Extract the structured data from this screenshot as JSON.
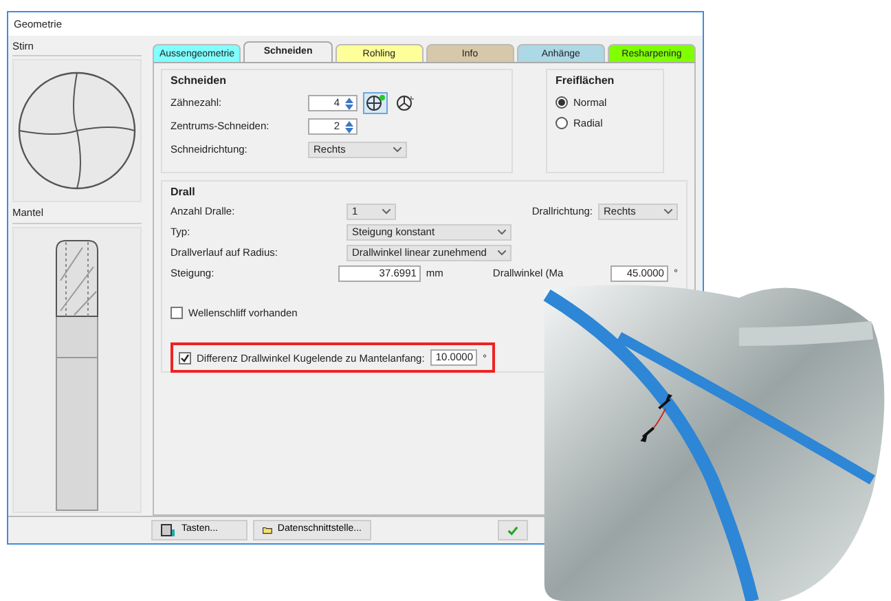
{
  "window": {
    "title": "Geometrie"
  },
  "left_panel": {
    "front_label": "Stirn",
    "shank_label": "Mantel"
  },
  "tabs": [
    {
      "label": "Aussengeometrie",
      "color": "#80ffff",
      "selected": false
    },
    {
      "label": "Schneiden",
      "color": "#f0f0f0",
      "selected": true
    },
    {
      "label": "Rohling",
      "color": "#ffff99",
      "selected": false
    },
    {
      "label": "Info",
      "color": "#d6c8a8",
      "selected": false
    },
    {
      "label": "Anhänge",
      "color": "#add8e6",
      "selected": false
    },
    {
      "label": "Resharpening",
      "color": "#80ff00",
      "selected": false
    }
  ],
  "schneiden": {
    "title": "Schneiden",
    "fields": [
      {
        "label": "Zähnezahl:",
        "value": "4",
        "kind": "spin"
      },
      {
        "label": "Zentrums-Schneiden:",
        "value": "2",
        "kind": "spin"
      },
      {
        "label": "Schneidrichtung:",
        "value": "Rechts",
        "kind": "select"
      }
    ],
    "tooth_modes": [
      {
        "selected": true
      },
      {
        "selected": false
      }
    ]
  },
  "freiflaechen": {
    "title": "Freiflächen",
    "options": [
      {
        "label": "Normal",
        "selected": true
      },
      {
        "label": "Radial",
        "selected": false
      }
    ]
  },
  "drall": {
    "title": "Drall",
    "rows": [
      {
        "label": "Anzahl Dralle:",
        "value": "1",
        "kind": "select_small"
      },
      {
        "label": "Typ:",
        "value": "Steigung konstant",
        "kind": "select"
      },
      {
        "label": "Drallverlauf auf Radius:",
        "value": "Drallwinkel linear zunehmend",
        "kind": "select"
      },
      {
        "label": "Steigung:",
        "value": "37.6991",
        "unit": "mm",
        "kind": "input"
      }
    ],
    "direction": {
      "label": "Drallrichtung:",
      "value": "Rechts"
    },
    "angle": {
      "label": "Drallwinkel (Ma",
      "value": "45.0000",
      "unit": "°"
    },
    "wave": {
      "label": "Wellenschliff vorhanden",
      "checked": false
    },
    "difference": {
      "label": "Differenz Drallwinkel Kugelende zu Mantelanfang:",
      "value": "10.0000",
      "unit": "°",
      "checked": true,
      "highlighted": true
    }
  },
  "buttons": [
    {
      "label": "Tasten...",
      "kind": "keys"
    },
    {
      "label": "Datenschnittstelle...",
      "kind": "folder"
    },
    {
      "kind": "ok"
    }
  ]
}
